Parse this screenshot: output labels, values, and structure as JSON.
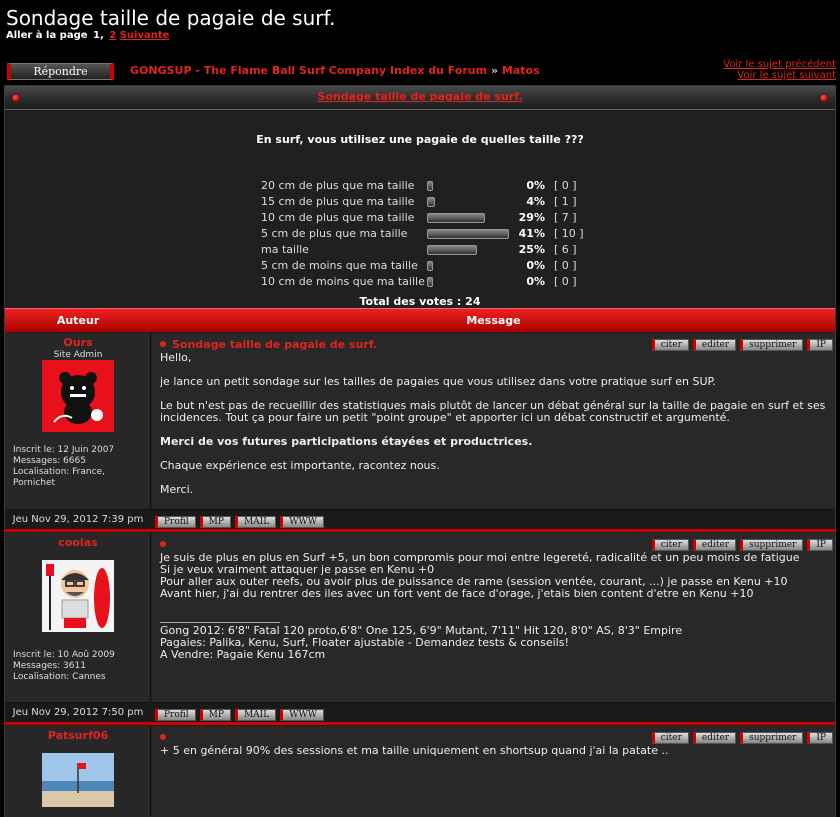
{
  "page": {
    "title": "Sondage taille de pagaie de surf.",
    "pagination": {
      "prefix": "Aller à la page",
      "current": "1,",
      "page2": "2",
      "next": "Suivante"
    }
  },
  "toolbar": {
    "reply_label": "Répondre",
    "breadcrumb": {
      "forum": "GONGSUP - The Flame Ball Surf Company Index du Forum",
      "separator": "»",
      "category": "Matos"
    },
    "prev_topic": "Voir le sujet précédent",
    "next_topic": "Voir le sujet suivant"
  },
  "topic": {
    "title": "Sondage taille de pagaie de surf."
  },
  "poll": {
    "question": "En surf, vous utilisez une pagaie de quelles taille ???",
    "options": [
      {
        "label": "20 cm de plus que ma taille",
        "percent": "0%",
        "count": "[ 0 ]",
        "fraction": 0.0
      },
      {
        "label": "15 cm de plus que ma taille",
        "percent": "4%",
        "count": "[ 1 ]",
        "fraction": 0.04
      },
      {
        "label": "10 cm de plus que ma taille",
        "percent": "29%",
        "count": "[ 7 ]",
        "fraction": 0.29
      },
      {
        "label": "5 cm de plus que ma taille",
        "percent": "41%",
        "count": "[ 10 ]",
        "fraction": 0.41
      },
      {
        "label": "ma taille",
        "percent": "25%",
        "count": "[ 6 ]",
        "fraction": 0.25
      },
      {
        "label": "5 cm de moins que ma taille",
        "percent": "0%",
        "count": "[ 0 ]",
        "fraction": 0.0
      },
      {
        "label": "10 cm de moins que ma taille",
        "percent": "0%",
        "count": "[ 0 ]",
        "fraction": 0.0
      }
    ],
    "total": "Total des votes : 24"
  },
  "table": {
    "col_author": "Auteur",
    "col_message": "Message"
  },
  "buttons": {
    "quote": "citer",
    "edit": "editer",
    "delete": "supprimer",
    "ip": "IP",
    "profile": "Profil",
    "pm": "MP",
    "mail": "MAIL",
    "www": "WWW"
  },
  "posts": [
    {
      "username": "Ours",
      "rank": "Site Admin",
      "info": [
        "Inscrit le: 12 Juin 2007",
        "Messages: 6665",
        "Localisation: France,",
        "Pornichet"
      ],
      "subject": "Sondage taille de pagaie de surf.",
      "paragraphs": [
        "Hello,",
        "je lance un petit sondage sur les tailles de pagaies que vous utilisez dans votre pratique surf en SUP.",
        "Le but n'est pas de recueillir des statistiques mais plutôt de lancer un débat général sur la taille de pagaie en surf et ses incidences. Tout ça pour faire un petit \"point groupe\" et apporter ici un débat constructif et argumenté.",
        "Merci de vos futures participations étayées et productrices.",
        "Chaque expérience est importante, racontez nous.",
        "Merci."
      ],
      "date": "Jeu Nov 29, 2012 7:39 pm"
    },
    {
      "username": "coolas",
      "info": [
        "Inscrit le: 10 Aoû 2009",
        "Messages: 3611",
        "Localisation: Cannes"
      ],
      "lines": [
        "Je suis de plus en plus en Surf +5, un bon compromis pour moi entre legereté, radicalité et un peu moins de fatigue",
        "Si je veux vraiment attaquer je passe en Kenu +0",
        "Pour aller aux outer reefs, ou avoir plus de puissance de rame (session ventée, courant, ...) je passe en Kenu +10",
        "Avant hier, j'ai du rentrer des iles avec un fort vent de face d'orage, j'etais bien content d'etre en Kenu +10"
      ],
      "signature": [
        "Gong 2012: 6'8\" Fatal 120 proto,6'8\" One 125, 6'9\" Mutant, 7'11\" Hit 120, 8'0\" AS, 8'3\" Empire",
        "Pagaies: Palika, Kenu, Surf, Floater ajustable - Demandez tests & conseils!",
        "A Vendre: Pagaie Kenu 167cm"
      ],
      "date": "Jeu Nov 29, 2012 7:50 pm"
    },
    {
      "username": "Patsurf06",
      "lines": [
        "+ 5 en général 90% des sessions et ma taille uniquement en shortsup quand j'ai la patate .."
      ]
    }
  ],
  "colors": {
    "accent": "#e0241e",
    "header_red": "#cc0000",
    "background": "#000000",
    "panel": "#202020"
  }
}
